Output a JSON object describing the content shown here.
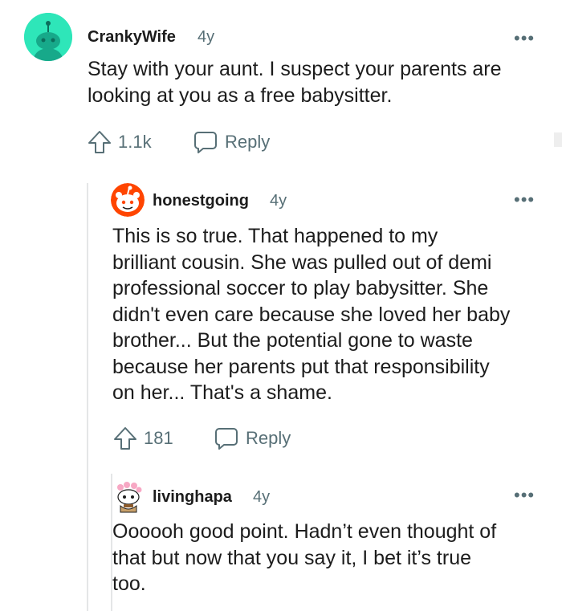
{
  "comments": [
    {
      "username": "CrankyWife",
      "age": "4y",
      "more": "•••",
      "lines": [
        "Stay with your aunt. I suspect your parents are",
        "looking at you as a free babysitter."
      ],
      "upvotes": "1.1k",
      "reply_label": "Reply",
      "avatar": "snoo-avatar-teal"
    },
    {
      "username": "honestgoing",
      "age": "4y",
      "more": "•••",
      "lines": [
        "This is so true. That happened to my",
        "brilliant cousin. She was pulled out of demi",
        "professional soccer to play babysitter. She",
        "didn't even care because she loved her baby",
        "brother... But the potential gone to waste",
        "because her parents put that responsibility",
        "on her... That's a shame."
      ],
      "upvotes": "181",
      "reply_label": "Reply",
      "avatar": "snoo-avatar-red"
    },
    {
      "username": "livinghapa",
      "age": "4y",
      "more": "•••",
      "lines": [
        "Oooooh good point. Hadn’t even thought of",
        "that but now that you say it, I bet it’s true",
        "too."
      ],
      "avatar": "snoo-avatar-flower"
    }
  ],
  "colors": {
    "text": "#1c1c1c",
    "meta": "#576f76",
    "avatar_teal": "#2ee6b9",
    "avatar_red": "#ff4500",
    "thread_line": "#e4e6e7"
  }
}
